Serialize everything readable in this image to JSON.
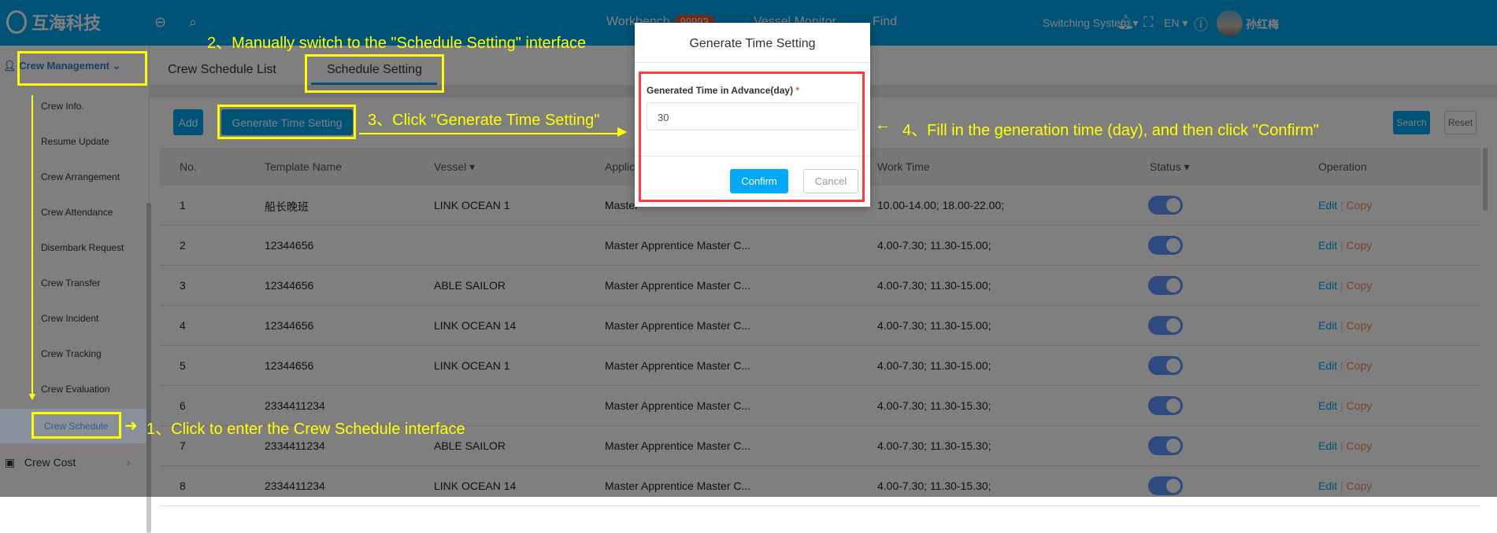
{
  "header": {
    "logo_text": "互海科技",
    "nav": [
      "Workbench",
      "Vessel Monitor",
      "Find"
    ],
    "workbench_badge": "99993",
    "switching": "Switching System",
    "language": "EN",
    "user": "孙红梅"
  },
  "sidebar": {
    "group": "Crew Management",
    "items": [
      "Crew Info.",
      "Resume Update",
      "Crew Arrangement",
      "Crew Attendance",
      "Disembark Request",
      "Crew Transfer",
      "Crew Incident",
      "Crew Tracking",
      "Crew Evaluation",
      "Crew Schedule"
    ],
    "active": "Crew Schedule",
    "next_group": "Crew Cost"
  },
  "tabs": [
    "Crew Schedule List",
    "Schedule Setting"
  ],
  "toolbar": {
    "add": "Add",
    "generate": "Generate Time Setting",
    "search": "Search",
    "reset": "Reset"
  },
  "table": {
    "columns": [
      "No.",
      "Template Name",
      "Vessel",
      "Applic",
      "Work Time",
      "Status",
      "Operation"
    ],
    "rows": [
      {
        "no": "1",
        "name": "船长晚班",
        "vessel": "LINK OCEAN 1",
        "applic": "Master",
        "time": "10.00-14.00;   18.00-22.00;",
        "status": true
      },
      {
        "no": "2",
        "name": "12344656",
        "vessel": "",
        "applic": "Master Apprentice Master C...",
        "time": "4.00-7.30;   11.30-15.00;",
        "status": true
      },
      {
        "no": "3",
        "name": "12344656",
        "vessel": "ABLE SAILOR",
        "applic": "Master Apprentice Master C...",
        "time": "4.00-7.30;   11.30-15.00;",
        "status": true
      },
      {
        "no": "4",
        "name": "12344656",
        "vessel": "LINK OCEAN 14",
        "applic": "Master Apprentice Master C...",
        "time": "4.00-7.30;   11.30-15.00;",
        "status": true
      },
      {
        "no": "5",
        "name": "12344656",
        "vessel": "LINK OCEAN 1",
        "applic": "Master Apprentice Master C...",
        "time": "4.00-7.30;   11.30-15.00;",
        "status": true
      },
      {
        "no": "6",
        "name": "2334411234",
        "vessel": "",
        "applic": "Master Apprentice Master C...",
        "time": "4.00-7.30;   11.30-15.30;",
        "status": true
      },
      {
        "no": "7",
        "name": "2334411234",
        "vessel": "ABLE SAILOR",
        "applic": "Master Apprentice Master C...",
        "time": "4.00-7.30;   11.30-15.30;",
        "status": true
      },
      {
        "no": "8",
        "name": "2334411234",
        "vessel": "LINK OCEAN 14",
        "applic": "Master Apprentice Master C...",
        "time": "4.00-7.30;   11.30-15.30;",
        "status": true
      }
    ],
    "edit": "Edit",
    "copy": "Copy"
  },
  "modal": {
    "title": "Generate Time Setting",
    "label": "Generated Time in Advance(day)",
    "required": "*",
    "value": "30",
    "confirm": "Confirm",
    "cancel": "Cancel"
  },
  "annotations": {
    "step1": "1、Click to enter the Crew Schedule interface",
    "step2": "2、Manually switch to the \"Schedule Setting\" interface",
    "step3": "3、Click \"Generate Time Setting\"",
    "step4": "4、Fill in the generation time (day), and then click \"Confirm\""
  },
  "colors": {
    "header": "#00a4ef",
    "confirm": "#03a9f4",
    "annotation": "#ffff00",
    "highlight_box": "#ff3b3b"
  }
}
